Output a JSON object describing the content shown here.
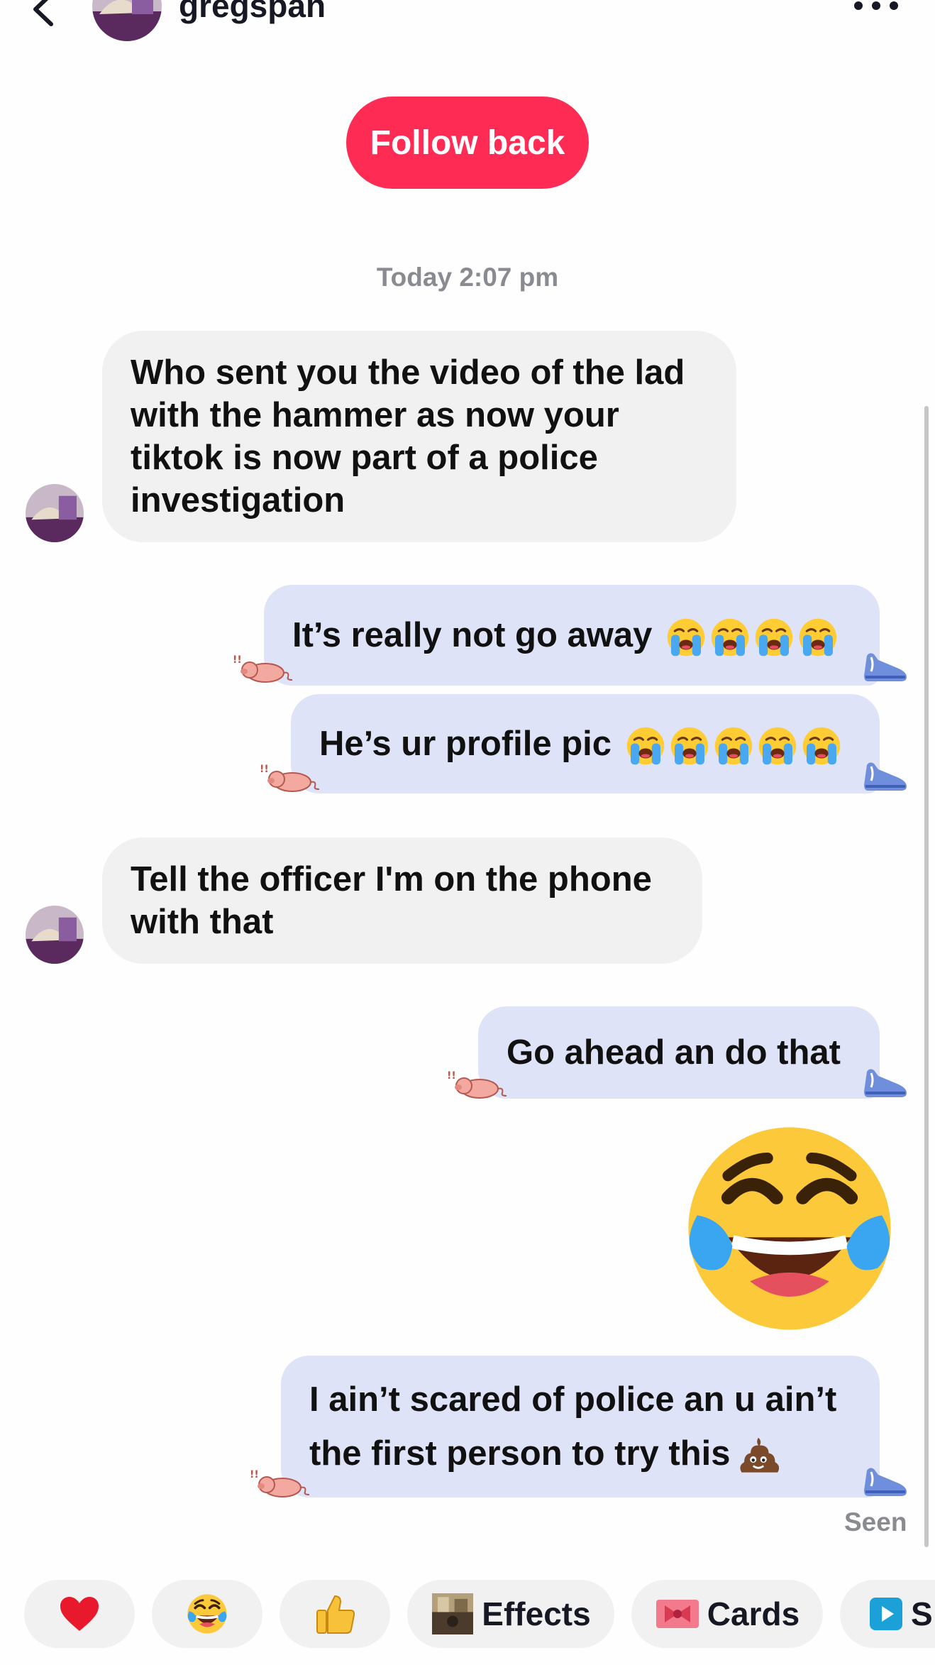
{
  "header": {
    "back_icon": "chevron-left-icon",
    "username": "gregspan",
    "more_icon": "ellipsis-icon"
  },
  "follow_button": {
    "label": "Follow back",
    "color": "#fe2c55"
  },
  "timestamp": "Today 2:07 pm",
  "messages": [
    {
      "side": "received",
      "lines": [
        "Who sent you the video of the lad",
        "with the hammer as now your",
        "tiktok is now part of a police",
        "investigation"
      ]
    },
    {
      "side": "sent",
      "text": "It’s really not go away",
      "emoji": "loudly-crying-face x4"
    },
    {
      "side": "sent",
      "text": "He’s ur profile pic",
      "emoji": "loudly-crying-face x5"
    },
    {
      "side": "received",
      "lines": [
        "Tell the officer I'm on the phone",
        "with that"
      ]
    },
    {
      "side": "sent",
      "text": "Go ahead an do that"
    },
    {
      "side": "sent",
      "emoji": "face-with-tears-of-joy"
    },
    {
      "side": "sent",
      "lines": [
        "I ain’t scared of police an u ain’t",
        "the first person to try this"
      ],
      "emoji": "pile-of-poo"
    }
  ],
  "status": {
    "seen": "Seen"
  },
  "quick_actions": [
    {
      "icon": "red-heart-icon"
    },
    {
      "icon": "tears-of-joy-icon"
    },
    {
      "icon": "thumbs-up-icon"
    },
    {
      "icon": "effects-thumbnail-icon",
      "label": "Effects"
    },
    {
      "icon": "cards-ribbon-icon",
      "label": "Cards"
    },
    {
      "icon": "play-icon",
      "label": "S"
    }
  ],
  "colors": {
    "sent_bubble": "#dfe3f8",
    "received_bubble": "#f1f1f2",
    "accent": "#fe2c55",
    "muted_text": "#8a8b91"
  }
}
